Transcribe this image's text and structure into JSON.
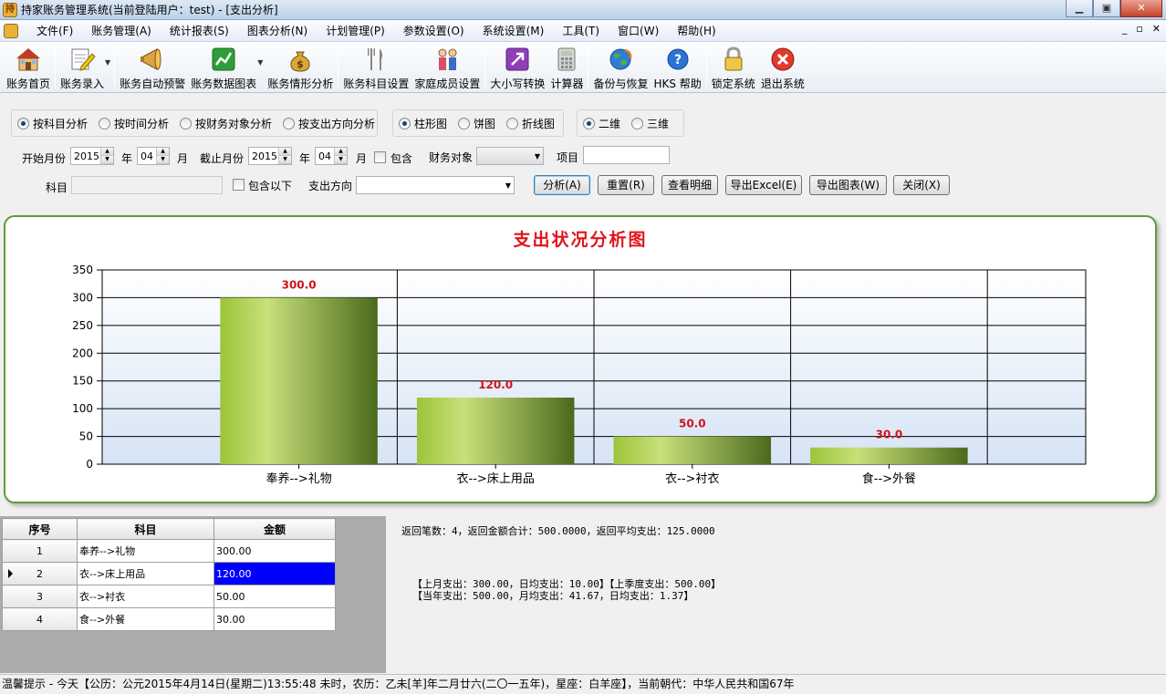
{
  "window": {
    "title": "持家账务管理系统(当前登陆用户：test) - [支出分析]",
    "min_glyph": "▁",
    "max_glyph": "▣",
    "close_glyph": "✕"
  },
  "menu": {
    "items": [
      "文件(F)",
      "账务管理(A)",
      "统计报表(S)",
      "图表分析(N)",
      "计划管理(P)",
      "参数设置(O)",
      "系统设置(M)",
      "工具(T)",
      "窗口(W)",
      "帮助(H)"
    ],
    "mdi_min": "_",
    "mdi_restore": "▫",
    "mdi_close": "✕"
  },
  "toolbar": {
    "home": "账务首页",
    "entry": "账务录入",
    "auto_alert": "账务自动预警",
    "data_chart": "账务数据图表",
    "situation": "账务情形分析",
    "subject_setup": "账务科目设置",
    "family_setup": "家庭成员设置",
    "case_convert": "大小写转换",
    "calculator": "计算器",
    "backup": "备份与恢复",
    "help": "HKS 帮助",
    "lock": "锁定系统",
    "exit": "退出系统"
  },
  "filters": {
    "analysis_modes": [
      "按科目分析",
      "按时间分析",
      "按财务对象分析",
      "按支出方向分析"
    ],
    "analysis_selected": 0,
    "chart_types": [
      "柱形图",
      "饼图",
      "折线图"
    ],
    "chart_type_selected": 0,
    "dimensions": [
      "二维",
      "三维"
    ],
    "dimension_selected": 0,
    "start_label": "开始月份",
    "start_year": "2015",
    "start_month": "04",
    "end_label": "截止月份",
    "end_year": "2015",
    "end_month": "04",
    "year_unit": "年",
    "month_unit": "月",
    "include_label": "包含",
    "finance_obj_label": "财务对象",
    "item_label": "项目",
    "subject_label": "科目",
    "include_below_label": "包含以下",
    "direction_label": "支出方向"
  },
  "buttons": {
    "analyze": "分析(A)",
    "reset": "重置(R)",
    "detail": "查看明细",
    "export_excel": "导出Excel(E)",
    "export_chart": "导出图表(W)",
    "close": "关闭(X)"
  },
  "chart_data": {
    "type": "bar",
    "title": "支出状况分析图",
    "categories": [
      "奉养-->礼物",
      "衣-->床上用品",
      "衣-->衬衣",
      "食-->外餐"
    ],
    "values": [
      300,
      120,
      50,
      30
    ],
    "value_labels": [
      "300.0",
      "120.0",
      "50.0",
      "30.0"
    ],
    "yticks": [
      "0",
      "50",
      "100",
      "150",
      "200",
      "250",
      "300",
      "350"
    ],
    "ylim": [
      0,
      350
    ],
    "grid": true,
    "xlabel": "",
    "ylabel": "",
    "colors": {
      "bar_light": "#c8e07a",
      "bar_dark": "#4a6a1c",
      "label": "#d0121a"
    }
  },
  "table": {
    "headers": [
      "序号",
      "科目",
      "金额"
    ],
    "rows": [
      [
        "1",
        "奉养-->礼物",
        "300.00"
      ],
      [
        "2",
        "衣-->床上用品",
        "120.00"
      ],
      [
        "3",
        "衣-->衬衣",
        "50.00"
      ],
      [
        "4",
        "食-->外餐",
        "30.00"
      ]
    ],
    "selected_row": 1
  },
  "summary": {
    "line": "返回笔数：4，返回金额合计：500.0000，返回平均支出：125.0000",
    "stats_line1": "【上月支出：300.00，日均支出：10.00】【上季度支出：500.00】",
    "stats_line2": "【当年支出：500.00，月均支出：41.67，日均支出：1.37】"
  },
  "status": {
    "text": "温馨提示 - 今天【公历：公元2015年4月14日(星期二)13:55:48 未时，农历：乙未[羊]年二月廿六(二〇一五年)，星座：白羊座】，当前朝代：中华人民共和国67年"
  }
}
